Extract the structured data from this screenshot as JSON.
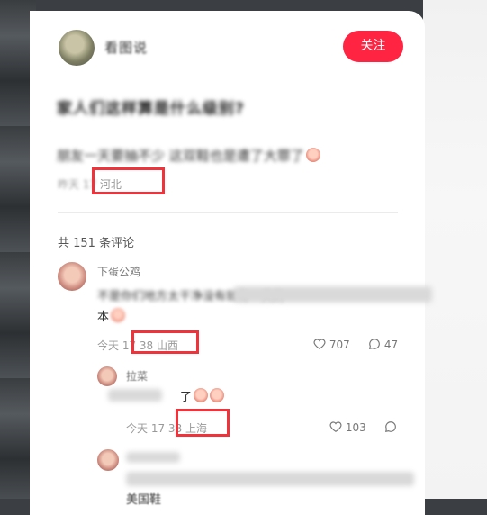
{
  "author": {
    "name": "看图说"
  },
  "follow_label": "关注",
  "post": {
    "title": "家人们这样算是什么级别?",
    "body_text": "朋友一天要抽不少 这双鞋也是遭了大罪了",
    "time": "昨天 17",
    "time_tail": "17",
    "location": "河北"
  },
  "comments_header": "共 151 条评论",
  "comments": [
    {
      "name": "下蛋公鸡",
      "line1": "不是你们地方太干净没有就有一天的",
      "line2": "本",
      "time_prefix": "今天 17",
      "time_suffix": "38",
      "location": "山西",
      "likes": "707",
      "replies": "47"
    },
    {
      "name": "拉菜",
      "line1": "了",
      "time_prefix": "今天 17",
      "time_suffix": "38",
      "location": "上海",
      "likes": "103",
      "replies": ""
    },
    {
      "name": "下蛋公鸡",
      "line1": "美国鞋"
    }
  ]
}
